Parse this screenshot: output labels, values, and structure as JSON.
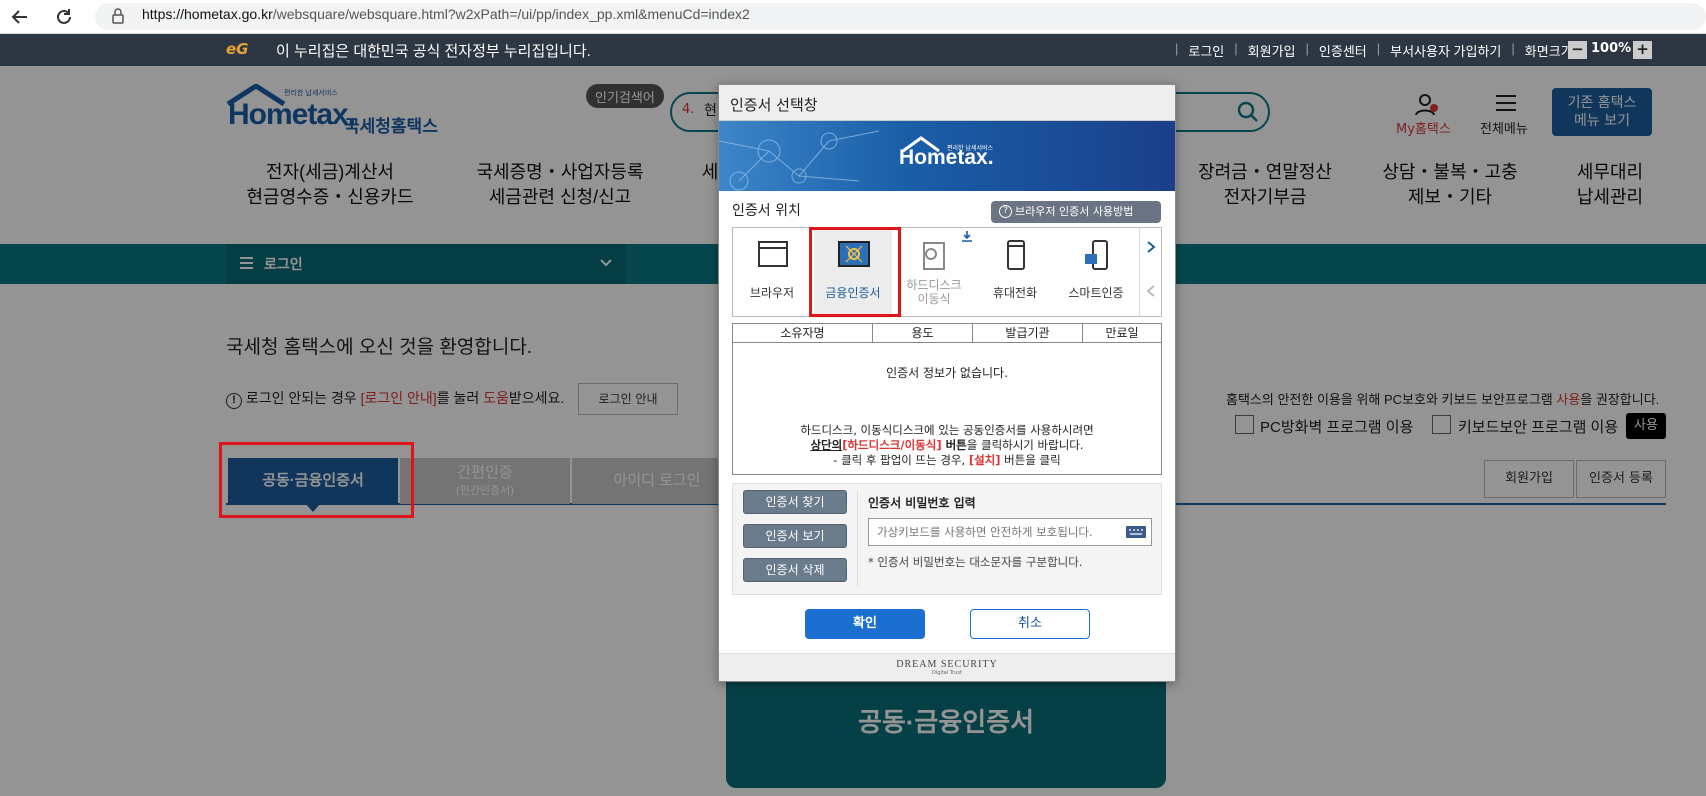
{
  "browser": {
    "url_host": "https://hometax.go.kr",
    "url_path": "/websquare/websquare.html?w2xPath=/ui/pp/index_pp.xml&menuCd=index2",
    "back_icon": "arrow-left-icon",
    "reload_icon": "reload-icon",
    "lock_icon": "lock-icon"
  },
  "gov_bar": {
    "logo_text": "eG",
    "notice": "이 누리집은 대한민국 공식 전자정부 누리집입니다.",
    "links": [
      "로그인",
      "회원가입",
      "인증센터",
      "부서사용자 가입하기",
      "화면크기"
    ],
    "zoom_minus": "−",
    "zoom_value": "100%",
    "zoom_plus": "+"
  },
  "header": {
    "logo_small": "편리한 납세서비스",
    "logo_main": "Hometax.",
    "logo_kor": "국세청홈택스",
    "popular_label": "인기검색어",
    "search_prefix": "4.",
    "search_value": "현",
    "my_hometax": "My홈택스",
    "all_menu": "전체메뉴",
    "legacy_btn_line1": "기존 홈택스",
    "legacy_btn_line2": "메뉴 보기"
  },
  "nav": [
    {
      "line1": "전자(세금)계산서",
      "line2": "현금영수증・신용카드"
    },
    {
      "line1": "국세증명・사업자등록",
      "line2": "세금관련 신청/신고"
    },
    {
      "line1": "세",
      "line2": ""
    },
    {
      "line1": "장려금・연말정산",
      "line2": "전자기부금"
    },
    {
      "line1": "상담・불복・고충",
      "line2": "제보・기타"
    },
    {
      "line1": "세무대리",
      "line2": "납세관리"
    }
  ],
  "breadcrumb": {
    "label": "로그인"
  },
  "welcome": "국세청 홈택스에 오신 것을 환영합니다.",
  "login_help": {
    "pre": "로그인 안되는 경우 ",
    "link": "[로그인 안내]",
    "mid": "를 눌러 ",
    "help": "도움",
    "post": "받으세요.",
    "button": "로그인 안내"
  },
  "security": {
    "notice_pre": "홈택스의 안전한 이용을 위해 PC보호와 키보드 보안프로그램 ",
    "notice_red": "사용",
    "notice_post": "을 권장합니다.",
    "pc_firewall": "PC방화벽 프로그램 이용",
    "keyboard": "키보드보안 프로그램 이용",
    "use_btn": "사용"
  },
  "tabs": [
    {
      "label": "공동·금융인증서",
      "sub": ""
    },
    {
      "label": "간편인증",
      "sub": "(민간인증서)"
    },
    {
      "label": "아이디 로그인",
      "sub": ""
    }
  ],
  "right_buttons": [
    "회원가입",
    "인증서 등록"
  ],
  "bottom_card": "공동·금융인증서",
  "dialog": {
    "title": "인증서 선택창",
    "banner_logo_small": "편리한 납세서비스",
    "banner_logo": "Hometax.",
    "location_label": "인증서 위치",
    "browser_help": "브라우저 인증서 사용방법",
    "locations": [
      {
        "label": "브라우저",
        "label2": "",
        "icon": "browser-window-icon"
      },
      {
        "label": "금융인증서",
        "label2": "",
        "icon": "financial-certificate-icon"
      },
      {
        "label": "하드디스크",
        "label2": "이동식",
        "icon": "hard-disk-icon"
      },
      {
        "label": "휴대전화",
        "label2": "",
        "icon": "mobile-phone-icon"
      },
      {
        "label": "스마트인증",
        "label2": "",
        "icon": "smart-cert-icon"
      }
    ],
    "table_headers": [
      "소유자명",
      "용도",
      "발급기관",
      "만료일"
    ],
    "empty_msg": "인증서 정보가 없습니다.",
    "hint_line1": "하드디스크, 이동식디스크에 있는 공동인증서를 사용하시려면",
    "hint_line2_a": "상단의",
    "hint_line2_b": "[하드디스크/이동식]",
    "hint_line2_c": " 버튼",
    "hint_line2_d": "을 클릭하시기 바랍니다.",
    "hint_line3_a": "- 클릭 후 팝업이 뜨는 경우, ",
    "hint_line3_b": "[설치]",
    "hint_line3_c": " 버튼을 클릭",
    "find_btn": "인증서 찾기",
    "view_btn": "인증서 보기",
    "delete_btn": "인증서 삭제",
    "pw_label": "인증서 비밀번호 입력",
    "pw_placeholder": "가상키보드를 사용하면 안전하게 보호됩니다.",
    "pw_note": "* 인증서 비밀번호는 대소문자를 구분합니다.",
    "ok_btn": "확인",
    "cancel_btn": "취소",
    "footer_brand": "DREAM SECURITY",
    "footer_sub": "Digital Trust"
  }
}
